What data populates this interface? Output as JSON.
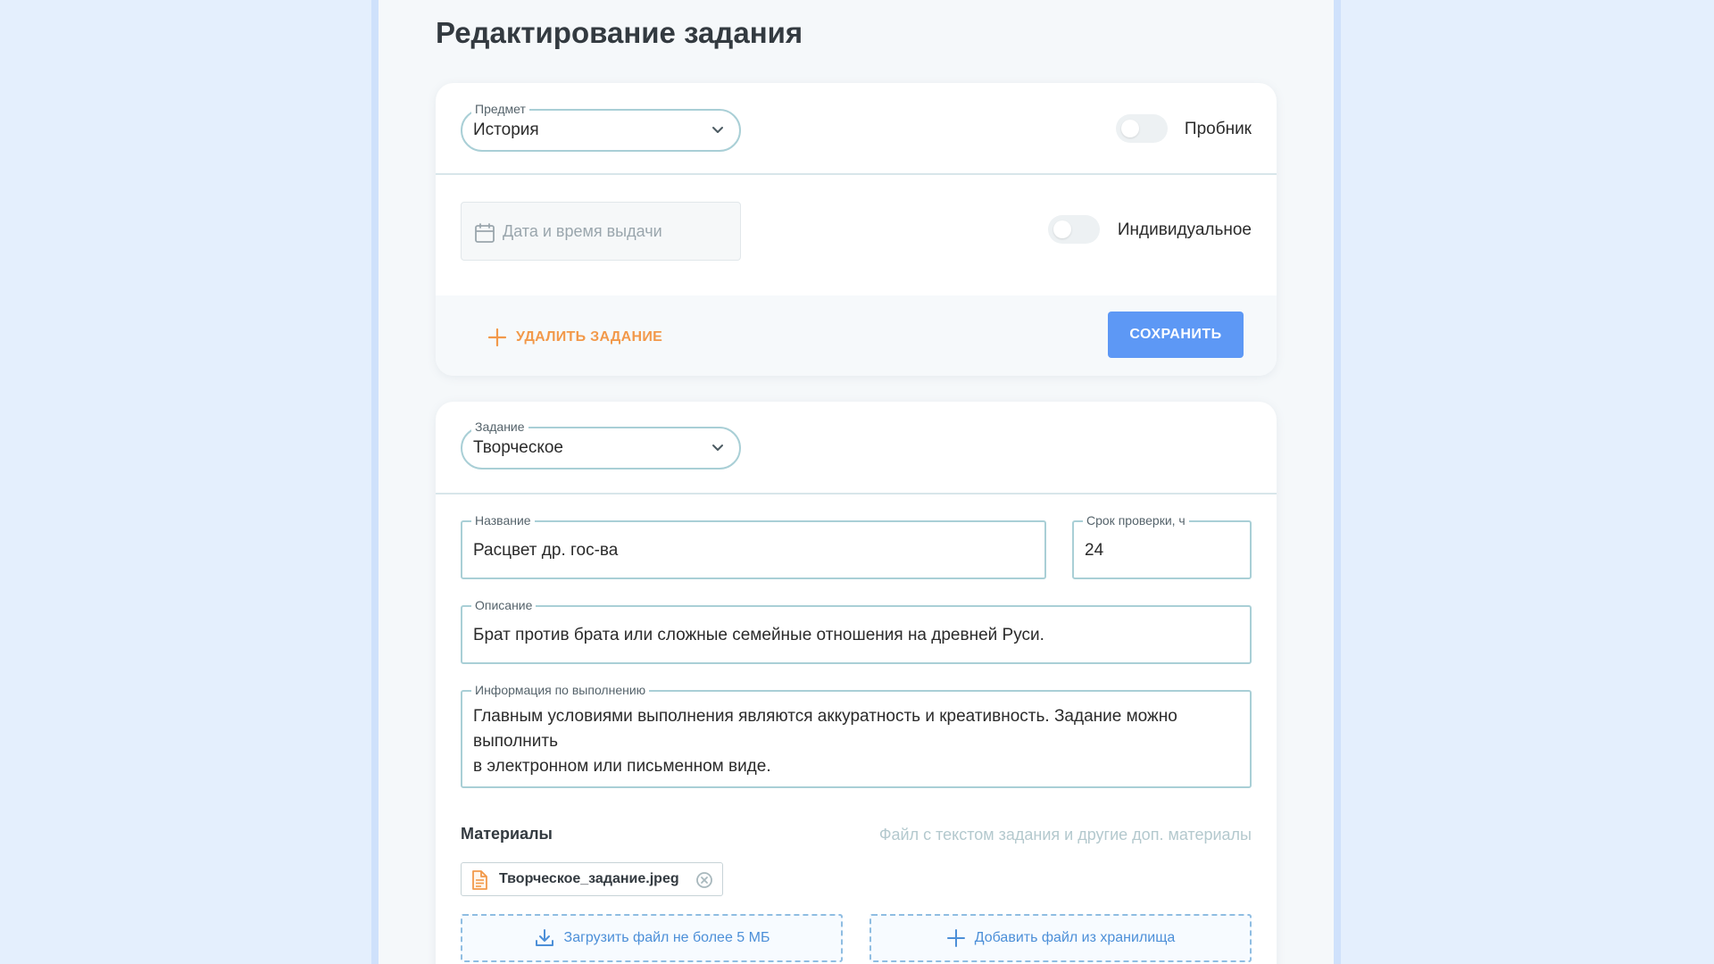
{
  "page": {
    "title": "Редактирование задания"
  },
  "card1": {
    "subject": {
      "label": "Предмет",
      "value": "История"
    },
    "trial_toggle": {
      "label": "Пробник",
      "on": false
    },
    "date": {
      "placeholder": "Дата и время выдачи"
    },
    "individual_toggle": {
      "label": "Индивидуальное",
      "on": false
    },
    "delete_label": "УДАЛИТЬ ЗАДАНИЕ",
    "save_label": "СОХРАНИТЬ"
  },
  "card2": {
    "task_type": {
      "label": "Задание",
      "value": "Творческое"
    },
    "name": {
      "label": "Название",
      "value": "Расцвет др. гос-ва"
    },
    "deadline": {
      "label": "Срок проверки, ч",
      "value": "24"
    },
    "description": {
      "label": "Описание",
      "value": "Брат против брата или сложные семейные отношения на древней Руси."
    },
    "info": {
      "label": "Информация по выполнению",
      "line1": "Главным условиями выполнения являются аккуратность и креативность. Задание можно",
      "line2": "выполнить",
      "line3": "в электронном или письменном виде."
    },
    "materials": {
      "title": "Материалы",
      "hint": "Файл с текстом задания и другие доп. материалы",
      "file_name": "Творческое_задание.jpeg",
      "upload_label": "Загрузить файл не более 5 МБ",
      "storage_label": "Добавить файл из хранилища"
    }
  },
  "colors": {
    "accent_blue": "#5d98f5",
    "accent_orange": "#f2994a",
    "field_border": "#a9cfd6",
    "background": "#e4effd"
  },
  "icons": [
    "chevron-down-icon",
    "calendar-icon",
    "plus-icon",
    "document-icon",
    "close-circle-icon",
    "download-icon"
  ]
}
